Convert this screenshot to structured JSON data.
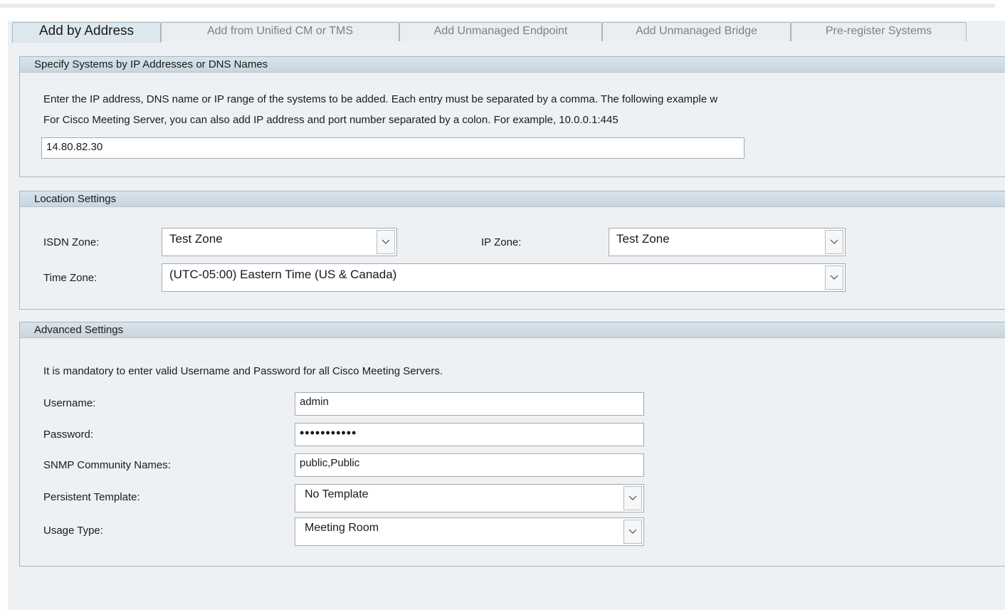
{
  "tabs": [
    {
      "label": "Add by Address",
      "active": true
    },
    {
      "label": "Add from Unified CM or TMS",
      "active": false
    },
    {
      "label": "Add Unmanaged Endpoint",
      "active": false
    },
    {
      "label": "Add Unmanaged Bridge",
      "active": false
    },
    {
      "label": "Pre-register Systems",
      "active": false
    }
  ],
  "specify": {
    "header": "Specify Systems by IP Addresses or DNS Names",
    "description_line1": "Enter the IP address, DNS name or IP range of the systems to be added. Each entry must be separated by a comma. The following example w",
    "description_line2": "For Cisco Meeting Server, you can also add IP address and port number separated by a colon. For example, 10.0.0.1:445",
    "address_value": "14.80.82.30"
  },
  "location": {
    "header": "Location Settings",
    "isdn_zone_label": "ISDN Zone:",
    "isdn_zone_value": "Test Zone",
    "ip_zone_label": "IP Zone:",
    "ip_zone_value": "Test Zone",
    "time_zone_label": "Time Zone:",
    "time_zone_value": "(UTC-05:00) Eastern Time (US & Canada)"
  },
  "advanced": {
    "header": "Advanced Settings",
    "note": "It is mandatory to enter valid Username and Password for all Cisco Meeting Servers.",
    "username_label": "Username:",
    "username_value": "admin",
    "password_label": "Password:",
    "password_value": "•••••••••••",
    "snmp_label": "SNMP Community Names:",
    "snmp_value": "public,Public",
    "template_label": "Persistent Template:",
    "template_value": "No Template",
    "usage_label": "Usage Type:",
    "usage_value": "Meeting Room"
  },
  "colors": {
    "panel_header": "#c8d6e0",
    "panel_bg": "#eef1f4",
    "border": "#a9b4be"
  }
}
